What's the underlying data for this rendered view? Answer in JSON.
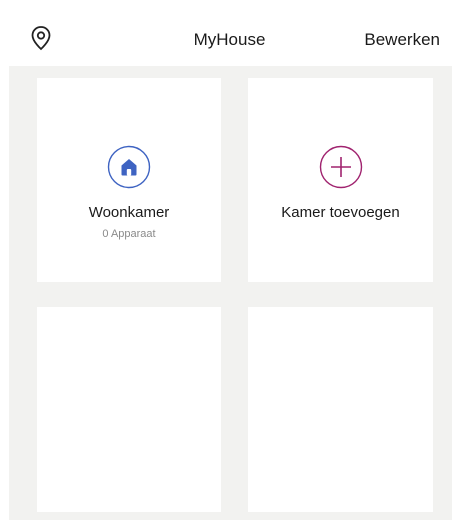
{
  "header": {
    "title": "MyHouse",
    "edit_label": "Bewerken",
    "location_icon": "location-pin-icon"
  },
  "rooms": [
    {
      "label": "Woonkamer",
      "sub": "0 Apparaat",
      "icon": "home-icon",
      "color": "#3e63c2"
    },
    {
      "label": "Kamer toevoegen",
      "icon": "add-icon",
      "color": "#a0236f"
    }
  ],
  "colors": {
    "background": "#f2f2f0",
    "card": "#ffffff"
  }
}
